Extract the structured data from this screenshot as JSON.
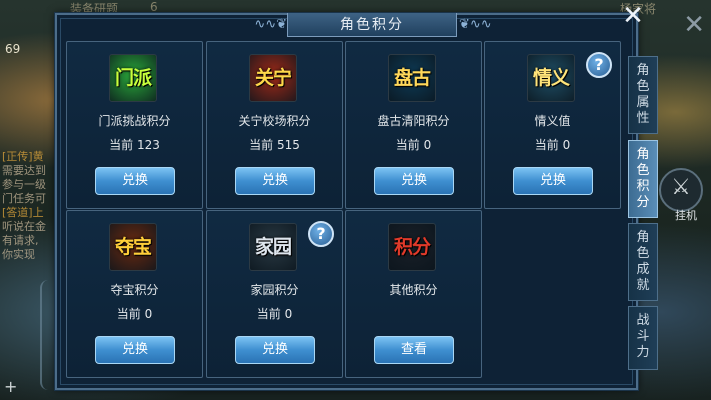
{
  "window": {
    "title": "角色积分"
  },
  "background": {
    "top_left_text": "装备研题",
    "top_mid_text": "6",
    "top_right_text": "杨家将",
    "side_top_number": "69",
    "left_chat": [
      {
        "tag": "[正传]黄",
        "text": "需要达到"
      },
      {
        "tag": "",
        "text": "参与一级"
      },
      {
        "tag": "",
        "text": "门任务可"
      },
      {
        "tag": "[答道]上",
        "text": "听说在金"
      },
      {
        "tag": "",
        "text": "有请求,"
      },
      {
        "tag": "",
        "text": "你实现"
      }
    ],
    "hangup_label": "挂机"
  },
  "cards": [
    {
      "icon_text": "门派",
      "icon_colors": {
        "bg": "#2aa93a",
        "fg": "#c8ff3c"
      },
      "name": "门派挑战积分",
      "current": "当前 123",
      "button": "兑换"
    },
    {
      "icon_text": "关宁",
      "icon_colors": {
        "bg": "#a02a18",
        "fg": "#ffd84a"
      },
      "name": "关宁校场积分",
      "current": "当前 515",
      "button": "兑换"
    },
    {
      "icon_text": "盘古",
      "icon_colors": {
        "bg": "#0e3b56",
        "fg": "#ffd85a"
      },
      "name": "盘古清阳积分",
      "current": "当前 0",
      "button": "兑换"
    },
    {
      "icon_text": "情义",
      "icon_colors": {
        "bg": "#1f4f66",
        "fg": "#ffe47a"
      },
      "name": "情义值",
      "current": "当前 0",
      "button": "兑换"
    },
    {
      "icon_text": "夺宝",
      "icon_colors": {
        "bg": "#6b2a10",
        "fg": "#ffcf3a"
      },
      "name": "夺宝积分",
      "current": "当前 0",
      "button": "兑换"
    },
    {
      "icon_text": "家园",
      "icon_colors": {
        "bg": "#2a3a44",
        "fg": "#dfe6ee"
      },
      "name": "家园积分",
      "current": "当前 0",
      "button": "兑换"
    },
    {
      "icon_text": "积分",
      "icon_colors": {
        "bg": "#1a2028",
        "fg": "#e23a2a"
      },
      "name": "其他积分",
      "current": "",
      "button": "查看"
    }
  ],
  "help_label": "?",
  "close_label": "✕",
  "tabs": [
    {
      "label": "角色属性",
      "active": false
    },
    {
      "label": "角色积分",
      "active": true
    },
    {
      "label": "角色成就",
      "active": false
    },
    {
      "label": "战斗力",
      "active": false
    }
  ]
}
